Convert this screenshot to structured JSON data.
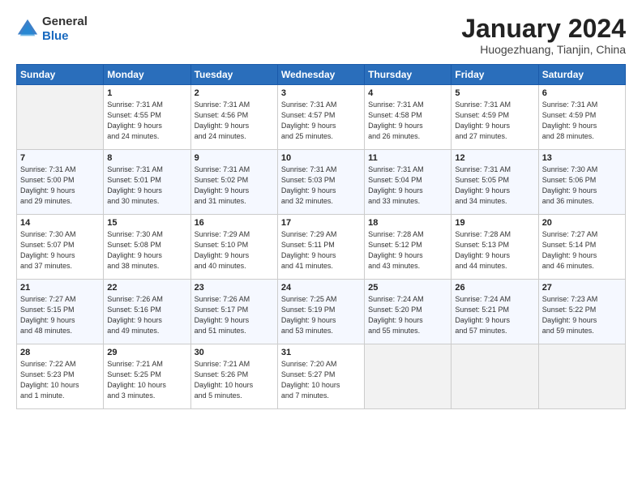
{
  "header": {
    "logo_general": "General",
    "logo_blue": "Blue",
    "month_title": "January 2024",
    "subtitle": "Huogezhuang, Tianjin, China"
  },
  "weekdays": [
    "Sunday",
    "Monday",
    "Tuesday",
    "Wednesday",
    "Thursday",
    "Friday",
    "Saturday"
  ],
  "weeks": [
    [
      {
        "day": "",
        "info": ""
      },
      {
        "day": "1",
        "info": "Sunrise: 7:31 AM\nSunset: 4:55 PM\nDaylight: 9 hours\nand 24 minutes."
      },
      {
        "day": "2",
        "info": "Sunrise: 7:31 AM\nSunset: 4:56 PM\nDaylight: 9 hours\nand 24 minutes."
      },
      {
        "day": "3",
        "info": "Sunrise: 7:31 AM\nSunset: 4:57 PM\nDaylight: 9 hours\nand 25 minutes."
      },
      {
        "day": "4",
        "info": "Sunrise: 7:31 AM\nSunset: 4:58 PM\nDaylight: 9 hours\nand 26 minutes."
      },
      {
        "day": "5",
        "info": "Sunrise: 7:31 AM\nSunset: 4:59 PM\nDaylight: 9 hours\nand 27 minutes."
      },
      {
        "day": "6",
        "info": "Sunrise: 7:31 AM\nSunset: 4:59 PM\nDaylight: 9 hours\nand 28 minutes."
      }
    ],
    [
      {
        "day": "7",
        "info": "Sunrise: 7:31 AM\nSunset: 5:00 PM\nDaylight: 9 hours\nand 29 minutes."
      },
      {
        "day": "8",
        "info": "Sunrise: 7:31 AM\nSunset: 5:01 PM\nDaylight: 9 hours\nand 30 minutes."
      },
      {
        "day": "9",
        "info": "Sunrise: 7:31 AM\nSunset: 5:02 PM\nDaylight: 9 hours\nand 31 minutes."
      },
      {
        "day": "10",
        "info": "Sunrise: 7:31 AM\nSunset: 5:03 PM\nDaylight: 9 hours\nand 32 minutes."
      },
      {
        "day": "11",
        "info": "Sunrise: 7:31 AM\nSunset: 5:04 PM\nDaylight: 9 hours\nand 33 minutes."
      },
      {
        "day": "12",
        "info": "Sunrise: 7:31 AM\nSunset: 5:05 PM\nDaylight: 9 hours\nand 34 minutes."
      },
      {
        "day": "13",
        "info": "Sunrise: 7:30 AM\nSunset: 5:06 PM\nDaylight: 9 hours\nand 36 minutes."
      }
    ],
    [
      {
        "day": "14",
        "info": "Sunrise: 7:30 AM\nSunset: 5:07 PM\nDaylight: 9 hours\nand 37 minutes."
      },
      {
        "day": "15",
        "info": "Sunrise: 7:30 AM\nSunset: 5:08 PM\nDaylight: 9 hours\nand 38 minutes."
      },
      {
        "day": "16",
        "info": "Sunrise: 7:29 AM\nSunset: 5:10 PM\nDaylight: 9 hours\nand 40 minutes."
      },
      {
        "day": "17",
        "info": "Sunrise: 7:29 AM\nSunset: 5:11 PM\nDaylight: 9 hours\nand 41 minutes."
      },
      {
        "day": "18",
        "info": "Sunrise: 7:28 AM\nSunset: 5:12 PM\nDaylight: 9 hours\nand 43 minutes."
      },
      {
        "day": "19",
        "info": "Sunrise: 7:28 AM\nSunset: 5:13 PM\nDaylight: 9 hours\nand 44 minutes."
      },
      {
        "day": "20",
        "info": "Sunrise: 7:27 AM\nSunset: 5:14 PM\nDaylight: 9 hours\nand 46 minutes."
      }
    ],
    [
      {
        "day": "21",
        "info": "Sunrise: 7:27 AM\nSunset: 5:15 PM\nDaylight: 9 hours\nand 48 minutes."
      },
      {
        "day": "22",
        "info": "Sunrise: 7:26 AM\nSunset: 5:16 PM\nDaylight: 9 hours\nand 49 minutes."
      },
      {
        "day": "23",
        "info": "Sunrise: 7:26 AM\nSunset: 5:17 PM\nDaylight: 9 hours\nand 51 minutes."
      },
      {
        "day": "24",
        "info": "Sunrise: 7:25 AM\nSunset: 5:19 PM\nDaylight: 9 hours\nand 53 minutes."
      },
      {
        "day": "25",
        "info": "Sunrise: 7:24 AM\nSunset: 5:20 PM\nDaylight: 9 hours\nand 55 minutes."
      },
      {
        "day": "26",
        "info": "Sunrise: 7:24 AM\nSunset: 5:21 PM\nDaylight: 9 hours\nand 57 minutes."
      },
      {
        "day": "27",
        "info": "Sunrise: 7:23 AM\nSunset: 5:22 PM\nDaylight: 9 hours\nand 59 minutes."
      }
    ],
    [
      {
        "day": "28",
        "info": "Sunrise: 7:22 AM\nSunset: 5:23 PM\nDaylight: 10 hours\nand 1 minute."
      },
      {
        "day": "29",
        "info": "Sunrise: 7:21 AM\nSunset: 5:25 PM\nDaylight: 10 hours\nand 3 minutes."
      },
      {
        "day": "30",
        "info": "Sunrise: 7:21 AM\nSunset: 5:26 PM\nDaylight: 10 hours\nand 5 minutes."
      },
      {
        "day": "31",
        "info": "Sunrise: 7:20 AM\nSunset: 5:27 PM\nDaylight: 10 hours\nand 7 minutes."
      },
      {
        "day": "",
        "info": ""
      },
      {
        "day": "",
        "info": ""
      },
      {
        "day": "",
        "info": ""
      }
    ]
  ]
}
